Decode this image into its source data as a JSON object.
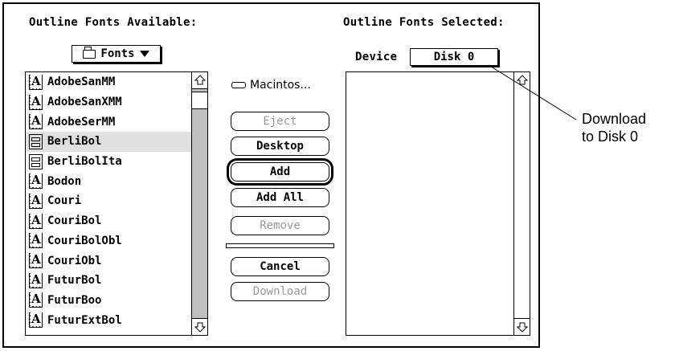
{
  "available": {
    "header": "Outline Fonts Available:",
    "folder_popup": "Fonts",
    "fonts": [
      {
        "name": "AdobeSanMM",
        "icon": "outline-font-icon",
        "selected": false
      },
      {
        "name": "AdobeSanXMM",
        "icon": "outline-font-icon",
        "selected": false
      },
      {
        "name": "AdobeSerMM",
        "icon": "outline-font-icon",
        "selected": false
      },
      {
        "name": "BerliBol",
        "icon": "bitmap-font-icon",
        "selected": true
      },
      {
        "name": "BerliBolIta",
        "icon": "bitmap-font-icon",
        "selected": false
      },
      {
        "name": "Bodon",
        "icon": "outline-font-icon",
        "selected": false
      },
      {
        "name": "Couri",
        "icon": "outline-font-icon",
        "selected": false
      },
      {
        "name": "CouriBol",
        "icon": "outline-font-icon",
        "selected": false
      },
      {
        "name": "CouriBolObl",
        "icon": "outline-font-icon",
        "selected": false
      },
      {
        "name": "CouriObl",
        "icon": "outline-font-icon",
        "selected": false
      },
      {
        "name": "FuturBol",
        "icon": "outline-font-icon",
        "selected": false
      },
      {
        "name": "FuturBoo",
        "icon": "outline-font-icon",
        "selected": false
      },
      {
        "name": "FuturExtBol",
        "icon": "outline-font-icon",
        "selected": false
      }
    ]
  },
  "selected": {
    "header": "Outline Fonts Selected:",
    "device_label": "Device",
    "device_value": "Disk 0"
  },
  "middle": {
    "disk_name": "Macintos...",
    "buttons": {
      "eject": "Eject",
      "desktop": "Desktop",
      "add": "Add",
      "add_all": "Add All",
      "remove": "Remove",
      "cancel": "Cancel",
      "download": "Download"
    }
  },
  "annotation": {
    "line1": "Download",
    "line2": "to Disk 0"
  }
}
